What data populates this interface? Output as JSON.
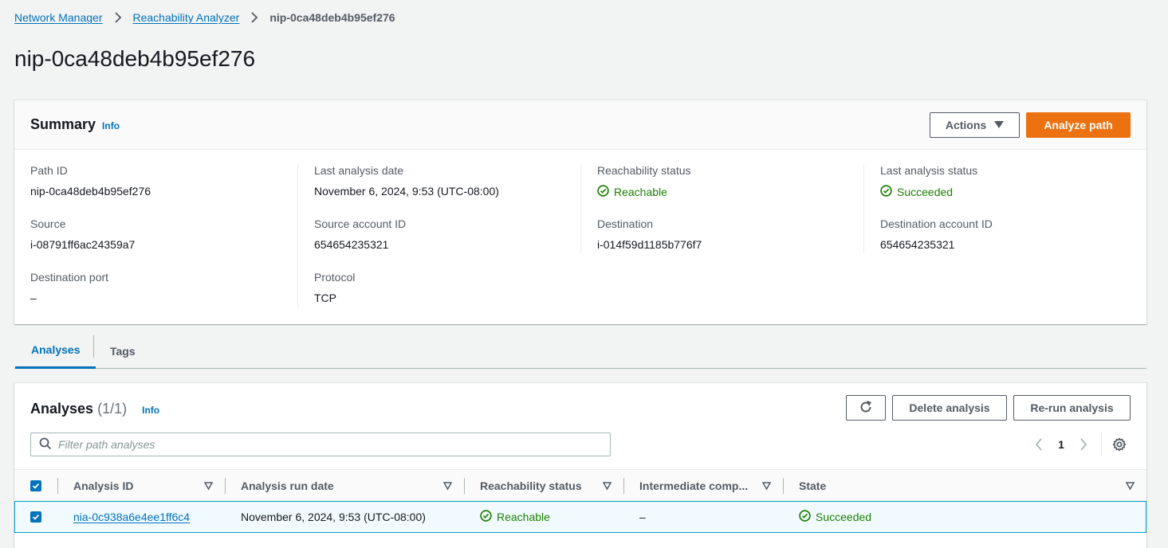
{
  "breadcrumb": {
    "items": [
      "Network Manager",
      "Reachability Analyzer"
    ],
    "current": "nip-0ca48deb4b95ef276"
  },
  "page": {
    "title": "nip-0ca48deb4b95ef276"
  },
  "summary": {
    "title": "Summary",
    "info": "Info",
    "actions_label": "Actions",
    "analyze_label": "Analyze path",
    "fields": {
      "path_id": {
        "label": "Path ID",
        "value": "nip-0ca48deb4b95ef276"
      },
      "last_analysis_date": {
        "label": "Last analysis date",
        "value": "November 6, 2024, 9:53 (UTC-08:00)"
      },
      "reachability_status": {
        "label": "Reachability status",
        "value": "Reachable"
      },
      "last_analysis_status": {
        "label": "Last analysis status",
        "value": "Succeeded"
      },
      "source": {
        "label": "Source",
        "value": "i-08791ff6ac24359a7"
      },
      "source_account_id": {
        "label": "Source account ID",
        "value": "654654235321"
      },
      "destination": {
        "label": "Destination",
        "value": "i-014f59d1185b776f7"
      },
      "destination_account_id": {
        "label": "Destination account ID",
        "value": "654654235321"
      },
      "destination_port": {
        "label": "Destination port",
        "value": "–"
      },
      "protocol": {
        "label": "Protocol",
        "value": "TCP"
      }
    }
  },
  "tabs": [
    {
      "label": "Analyses",
      "active": true
    },
    {
      "label": "Tags",
      "active": false
    }
  ],
  "analyses": {
    "title": "Analyses",
    "count": "(1/1)",
    "info": "Info",
    "delete_label": "Delete analysis",
    "rerun_label": "Re-run analysis",
    "search_placeholder": "Filter path analyses",
    "page": "1",
    "columns": [
      "Analysis ID",
      "Analysis run date",
      "Reachability status",
      "Intermediate comp...",
      "State"
    ],
    "rows": [
      {
        "id": "nia-0c938a6e4ee1ff6c4",
        "run_date": "November 6, 2024, 9:53 (UTC-08:00)",
        "reachability": "Reachable",
        "intermediate": "–",
        "state": "Succeeded"
      }
    ]
  },
  "colors": {
    "link": "#0073bb",
    "primary": "#ec7211",
    "success": "#1d8102",
    "selected_row": "#f1faff"
  }
}
